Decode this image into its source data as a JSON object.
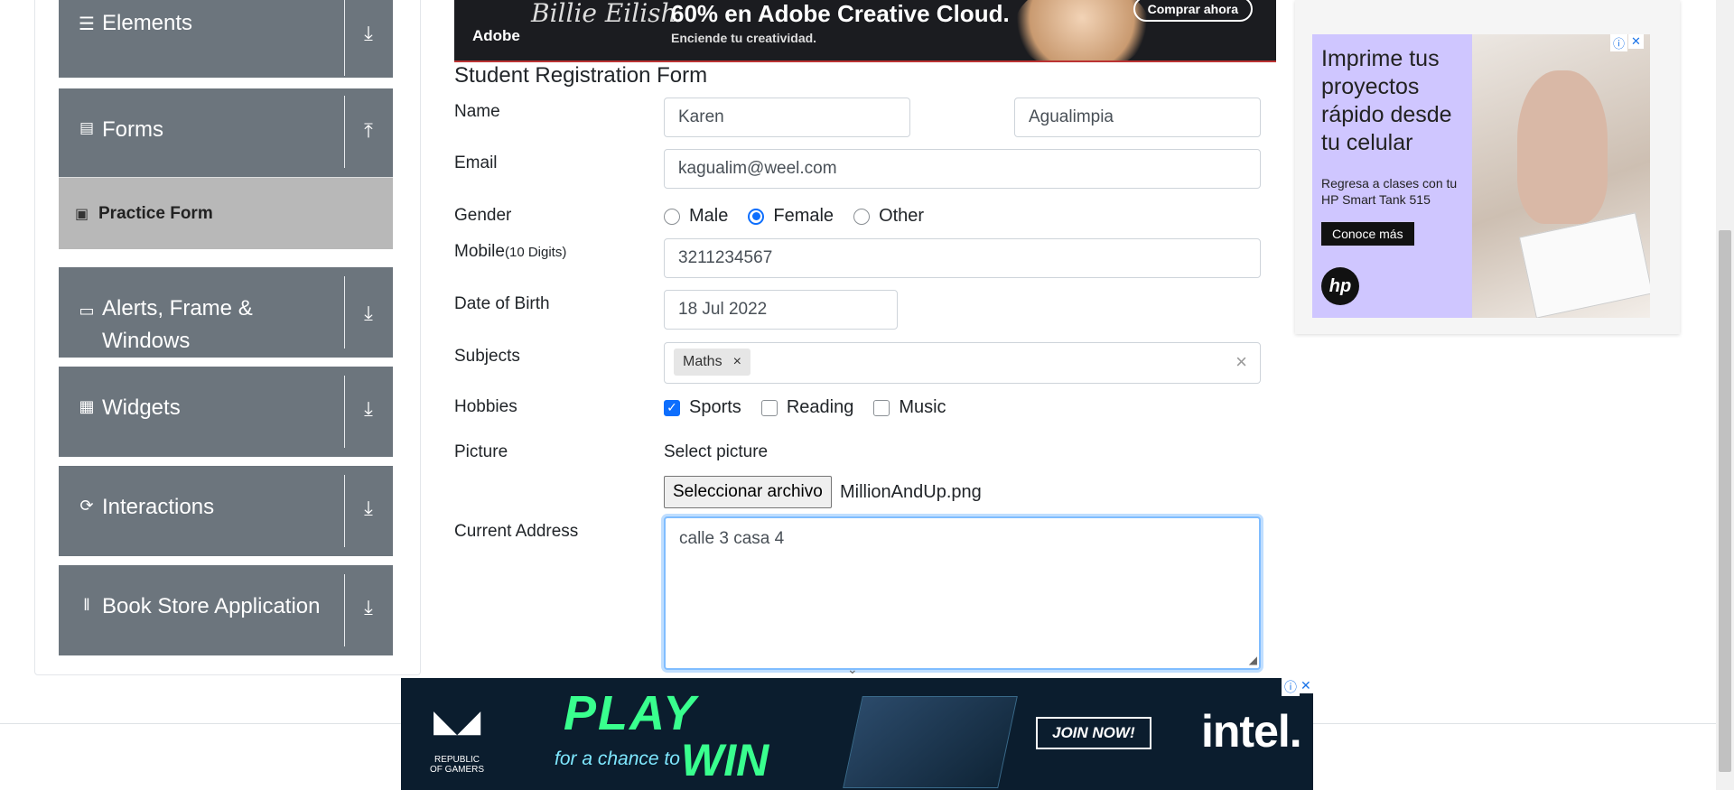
{
  "sidebar": {
    "groups": [
      {
        "label": "Elements",
        "icon": "hamburger-icon",
        "arrow": "download-arrow-icon"
      },
      {
        "label": "Forms",
        "icon": "form-icon",
        "arrow": "upload-arrow-icon"
      },
      {
        "label": "Alerts, Frame & Windows",
        "icon": "window-icon",
        "arrow": "download-arrow-icon"
      },
      {
        "label": "Widgets",
        "icon": "widgets-icon",
        "arrow": "download-arrow-icon"
      },
      {
        "label": "Interactions",
        "icon": "interactions-icon",
        "arrow": "download-arrow-icon"
      },
      {
        "label": "Book Store Application",
        "icon": "books-icon",
        "arrow": "download-arrow-icon"
      }
    ],
    "active_item": {
      "label": "Practice Form",
      "icon": "html5-icon"
    }
  },
  "top_ad": {
    "brand": "Adobe",
    "partner": "Billie Eilish",
    "headline": "60% en Adobe Creative Cloud.",
    "subline": "Enciende tu creatividad.",
    "cta": "Comprar ahora"
  },
  "form": {
    "title": "Student Registration Form",
    "labels": {
      "name": "Name",
      "email": "Email",
      "gender": "Gender",
      "mobile": "Mobile",
      "mobile_hint": "(10 Digits)",
      "dob": "Date of Birth",
      "subjects": "Subjects",
      "hobbies": "Hobbies",
      "picture": "Picture",
      "address": "Current Address"
    },
    "first_name": "Karen",
    "last_name": "Agualimpia",
    "email": "kagualim@weel.com",
    "gender_options": [
      "Male",
      "Female",
      "Other"
    ],
    "gender_selected": "Female",
    "mobile": "3211234567",
    "dob": "18 Jul 2022",
    "subjects": [
      "Maths"
    ],
    "subjects_clear": "×",
    "hobbies": [
      {
        "label": "Sports",
        "checked": true
      },
      {
        "label": "Reading",
        "checked": false
      },
      {
        "label": "Music",
        "checked": false
      }
    ],
    "picture_label": "Select picture",
    "file_button": "Seleccionar archivo",
    "file_name": "MillionAndUp.png",
    "address": "calle 3 casa 4"
  },
  "side_ad": {
    "headline": "Imprime tus proyectos rápido desde tu celular",
    "text": "Regresa a clases con tu HP Smart Tank 515",
    "cta": "Conoce más",
    "logo": "hp"
  },
  "bottom_ad": {
    "brand": "REPUBLIC OF GAMERS",
    "play": "PLAY",
    "for_a_chance": "for a chance to",
    "win": "WIN",
    "cta": "JOIN NOW!",
    "partner": "intel."
  }
}
